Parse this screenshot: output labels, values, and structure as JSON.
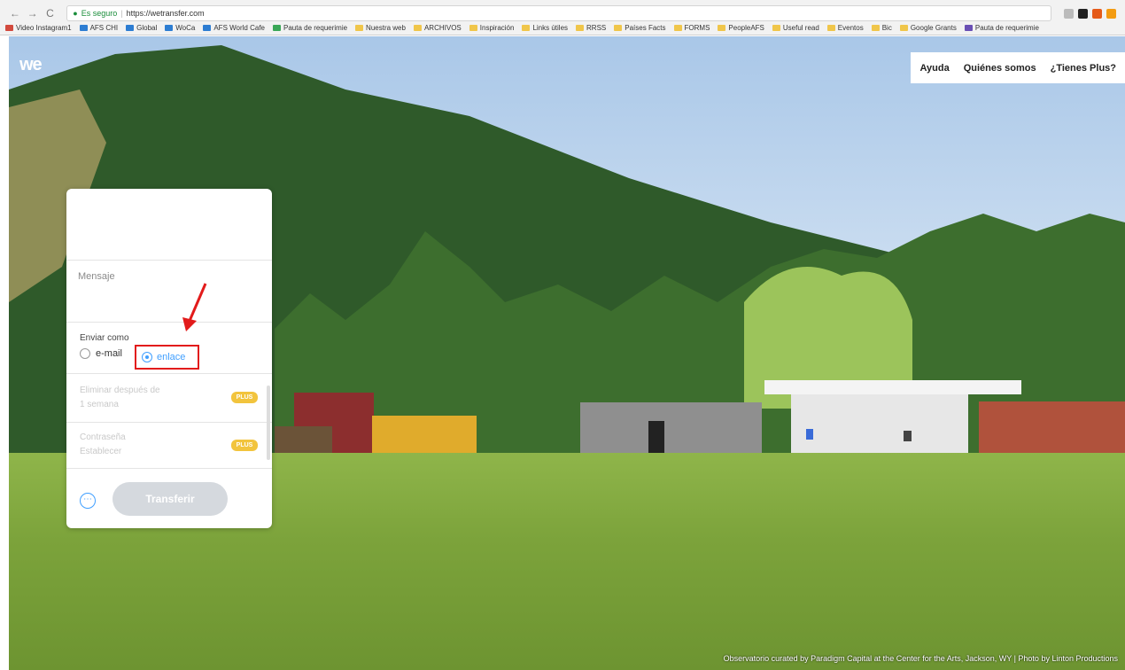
{
  "browser": {
    "nav": {
      "back": "←",
      "forward": "→",
      "reload": "C"
    },
    "secure_text": "Es seguro",
    "url": "https://wetransfer.com",
    "ext_colors": [
      "#bbbbbb",
      "#222222",
      "#e55b1a",
      "#f39c12"
    ]
  },
  "bookmarks": [
    {
      "label": "Video Instagram1",
      "color": "#d24a3e"
    },
    {
      "label": "AFS CHI",
      "color": "#2d7dd2"
    },
    {
      "label": "Global",
      "color": "#2d7dd2"
    },
    {
      "label": "WoCa",
      "color": "#2d7dd2"
    },
    {
      "label": "AFS World Cafe",
      "color": "#2d7dd2"
    },
    {
      "label": "Pauta de requerimie",
      "color": "#3aa757"
    },
    {
      "label": "Nuestra web",
      "color": "#f0c64a"
    },
    {
      "label": "ARCHIVOS",
      "color": "#f0c64a"
    },
    {
      "label": "Inspiración",
      "color": "#f0c64a"
    },
    {
      "label": "Links útiles",
      "color": "#f0c64a"
    },
    {
      "label": "RRSS",
      "color": "#f0c64a"
    },
    {
      "label": "Países Facts",
      "color": "#f0c64a"
    },
    {
      "label": "FORMS",
      "color": "#f0c64a"
    },
    {
      "label": "PeopleAFS",
      "color": "#f0c64a"
    },
    {
      "label": "Useful read",
      "color": "#f0c64a"
    },
    {
      "label": "Eventos",
      "color": "#f0c64a"
    },
    {
      "label": "Bic",
      "color": "#f0c64a"
    },
    {
      "label": "Google Grants",
      "color": "#f0c64a"
    },
    {
      "label": "Pauta de requerimie",
      "color": "#6a4fb4"
    }
  ],
  "header": {
    "logo": "we",
    "nav": [
      "Ayuda",
      "Quiénes somos",
      "¿Tienes Plus?"
    ]
  },
  "panel": {
    "message_label": "Mensaje",
    "send_as_label": "Enviar como",
    "option_email": "e-mail",
    "option_link": "enlace",
    "expires_label": "Eliminar después de",
    "expires_value": "1 semana",
    "password_label": "Contraseña",
    "password_value": "Establecer",
    "pro_badge": "PLUS",
    "more_icon": "⋯",
    "transfer_button": "Transferir"
  },
  "caption": "Observatorio curated by Paradigm Capital at the Center for the Arts, Jackson, WY | Photo by Linton Productions"
}
